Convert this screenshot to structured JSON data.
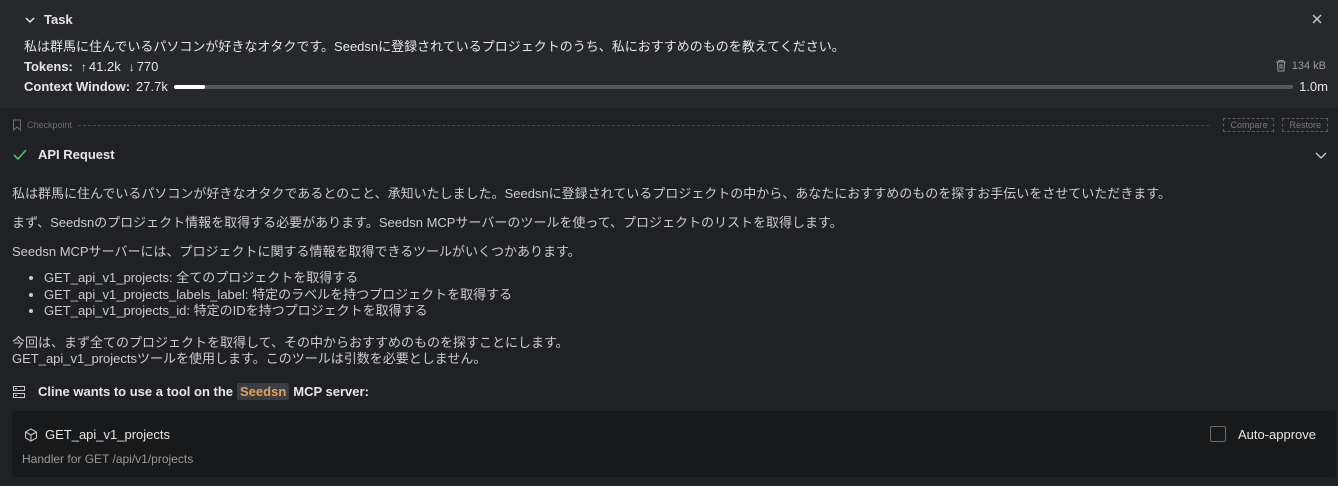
{
  "task": {
    "title": "Task",
    "text": "私は群馬に住んでいるパソコンが好きなオタクです。Seedsnに登録されているプロジェクトのうち、私におすすめのものを教えてください。",
    "tokens_label": "Tokens:",
    "tokens_in": "41.2k",
    "tokens_out": "770",
    "size": "134 kB",
    "context_label": "Context Window:",
    "context_used": "27.7k",
    "context_max": "1.0m",
    "context_fill_fraction": 0.028
  },
  "checkpoint": {
    "label": "Checkpoint",
    "compare_label": "Compare",
    "restore_label": "Restore"
  },
  "api_request": {
    "title": "API Request",
    "status": "success"
  },
  "message": {
    "paragraph1": "私は群馬に住んでいるパソコンが好きなオタクであるとのこと、承知いたしました。Seedsnに登録されているプロジェクトの中から、あなたにおすすめのものを探すお手伝いをさせていただきます。",
    "paragraph2": "まず、Seedsnのプロジェクト情報を取得する必要があります。Seedsn MCPサーバーのツールを使って、プロジェクトのリストを取得します。",
    "paragraph3": "Seedsn MCPサーバーには、プロジェクトに関する情報を取得できるツールがいくつかあります。",
    "bullets": [
      "GET_api_v1_projects: 全てのプロジェクトを取得する",
      "GET_api_v1_projects_labels_label: 特定のラベルを持つプロジェクトを取得する",
      "GET_api_v1_projects_id: 特定のIDを持つプロジェクトを取得する"
    ],
    "paragraph4_line1": "今回は、まず全てのプロジェクトを取得して、その中からおすすめのものを探すことにします。",
    "paragraph4_line2": "GET_api_v1_projectsツールを使用します。このツールは引数を必要としません。"
  },
  "tool_use": {
    "prefix": "Cline wants to use a tool on the",
    "server": "Seedsn",
    "suffix": "MCP server:",
    "tool_name": "GET_api_v1_projects",
    "tool_description": "Handler for GET /api/v1/projects",
    "auto_approve_label": "Auto-approve",
    "auto_approve_checked": false
  },
  "colors": {
    "background": "#1f2124",
    "header_background": "#26282b",
    "success_check": "#4ec36a",
    "server_chip_text": "#e0a060",
    "tool_box_background": "#18191b"
  }
}
